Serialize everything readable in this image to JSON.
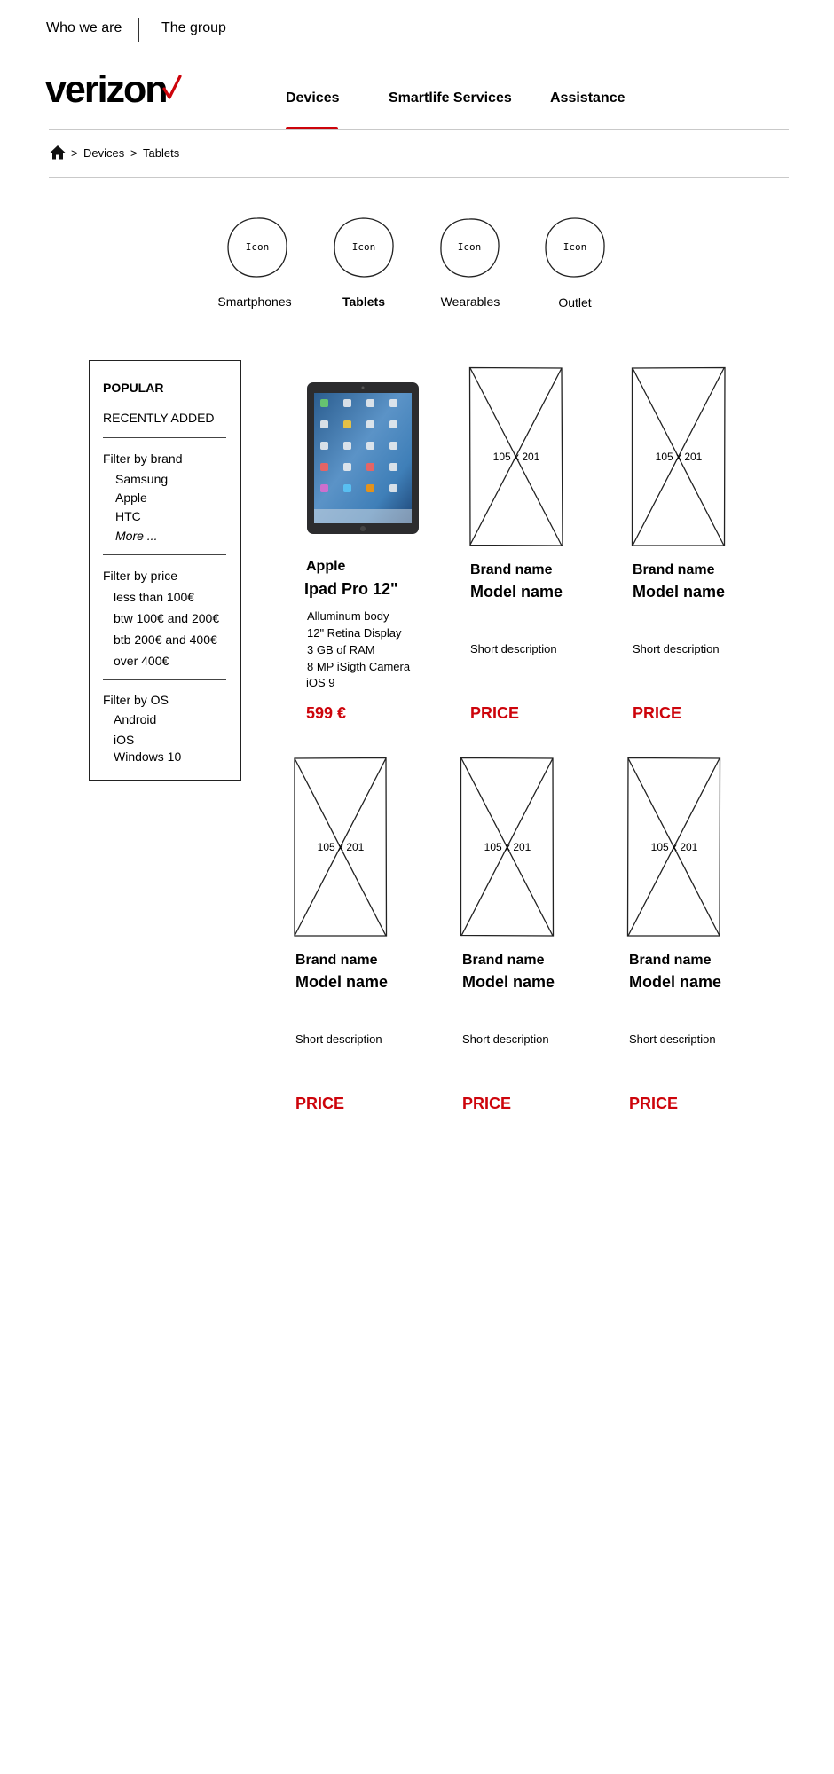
{
  "top_links": [
    "Who we are",
    "The group"
  ],
  "logo": {
    "text": "verizon",
    "check_color": "#cd040b"
  },
  "nav": {
    "items": [
      "Devices",
      "Smartlife Services",
      "Assistance"
    ],
    "active": "Devices"
  },
  "breadcrumb": {
    "items": [
      "Devices",
      "Tablets"
    ],
    "separator": ">"
  },
  "categories": [
    {
      "icon_text": "Icon",
      "label": "Smartphones"
    },
    {
      "icon_text": "Icon",
      "label": "Tablets",
      "active": true
    },
    {
      "icon_text": "Icon",
      "label": "Wearables"
    },
    {
      "icon_text": "Icon",
      "label": "Outlet"
    }
  ],
  "sidebar": {
    "popular": "POPULAR",
    "recently_added": "RECENTLY ADDED",
    "brand": {
      "title": "Filter by brand",
      "items": [
        "Samsung",
        "Apple",
        "HTC"
      ],
      "more": "More ..."
    },
    "price": {
      "title": "Filter by price",
      "items": [
        "less than 100€",
        "btw 100€ and 200€",
        "btb 200€ and 400€",
        "over 400€"
      ]
    },
    "os": {
      "title": "Filter by OS",
      "items": [
        "Android",
        "iOS",
        "Windows 10"
      ]
    }
  },
  "featured_product": {
    "brand": "Apple",
    "model": "Ipad Pro 12\"",
    "specs": [
      "Alluminum body",
      "12\" Retina Display",
      "3 GB of RAM",
      "8 MP iSigth Camera",
      "iOS 9"
    ],
    "price": "599 €",
    "price_color": "#cd040b"
  },
  "placeholder_products": [
    {
      "image_label": "105 x 201",
      "brand": "Brand name",
      "model": "Model name",
      "description": "Short description",
      "price": "PRICE"
    },
    {
      "image_label": "105 x 201",
      "brand": "Brand name",
      "model": "Model name",
      "description": "Short description",
      "price": "PRICE"
    },
    {
      "image_label": "105 x 201",
      "brand": "Brand name",
      "model": "Model name",
      "description": "Short description",
      "price": "PRICE"
    },
    {
      "image_label": "105 x 201",
      "brand": "Brand name",
      "model": "Model name",
      "description": "Short description",
      "price": "PRICE"
    },
    {
      "image_label": "105 x 201",
      "brand": "Brand name",
      "model": "Model name",
      "description": "Short description",
      "price": "PRICE"
    }
  ]
}
